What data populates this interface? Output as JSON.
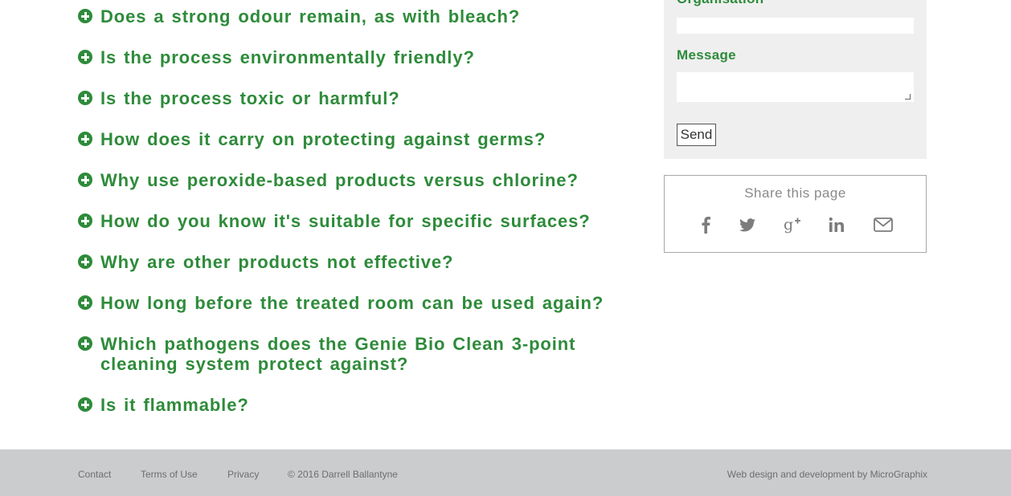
{
  "faq": {
    "items": [
      {
        "question": "Does a strong odour remain, as with bleach?"
      },
      {
        "question": "Is the process environmentally friendly?"
      },
      {
        "question": "Is the process toxic or harmful?"
      },
      {
        "question": "How does it carry on protecting against germs?"
      },
      {
        "question": "Why use peroxide-based products versus chlorine?"
      },
      {
        "question": "How do you know it's suitable for specific surfaces?"
      },
      {
        "question": "Why are other products not effective?"
      },
      {
        "question": "How long before the treated room can be used again?"
      },
      {
        "question": "Which pathogens does the Genie Bio Clean 3-point cleaning system protect against?"
      },
      {
        "question": "Is it flammable?"
      }
    ],
    "icon": "plus-circle-icon",
    "color": "#2e8b3a"
  },
  "contact_form": {
    "organisation_label": "Organisation",
    "organisation_value": "",
    "message_label": "Message",
    "message_value": "",
    "send_label": "Send"
  },
  "share": {
    "title": "Share this page",
    "icons": [
      "facebook-icon",
      "twitter-icon",
      "google-plus-icon",
      "linkedin-icon",
      "email-icon"
    ]
  },
  "footer": {
    "contact": "Contact",
    "terms": "Terms of Use",
    "privacy": "Privacy",
    "copyright": "© 2016 Darrell Ballantyne",
    "credit_prefix": "Web design and development by ",
    "credit_link": "MicroGraphix"
  }
}
